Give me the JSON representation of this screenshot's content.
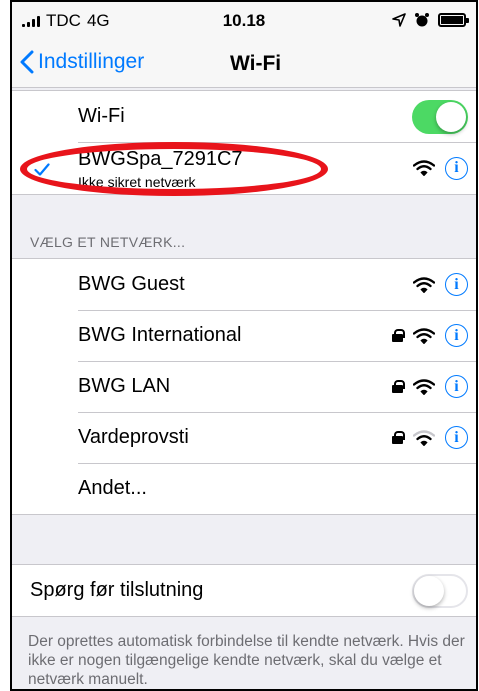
{
  "status_bar": {
    "carrier": "TDC",
    "network": "4G",
    "time": "10.18"
  },
  "nav": {
    "back_label": "Indstillinger",
    "title": "Wi-Fi"
  },
  "wifi": {
    "label": "Wi-Fi",
    "enabled": true
  },
  "current_network": {
    "name": "BWGSpa_7291C7",
    "subtitle": "Ikke sikret netværk",
    "info_label": "i"
  },
  "choose_header": "VÆLG ET NETVÆRK...",
  "networks": [
    {
      "name": "BWG Guest",
      "locked": false,
      "info_label": "i"
    },
    {
      "name": "BWG International",
      "locked": true,
      "info_label": "i"
    },
    {
      "name": "BWG LAN",
      "locked": true,
      "info_label": "i"
    },
    {
      "name": "Vardeprovsti",
      "locked": true,
      "info_label": "i"
    }
  ],
  "other_label": "Andet...",
  "ask_join": {
    "label": "Spørg før tilslutning",
    "enabled": false
  },
  "footer_text": "Der oprettes automatisk forbindelse til kendte netværk. Hvis der ikke er nogen tilgængelige kendte netværk, skal du vælge et netværk manuelt.",
  "colors": {
    "accent": "#007aff",
    "toggle_on": "#4cd964",
    "highlight": "#e8141b"
  }
}
